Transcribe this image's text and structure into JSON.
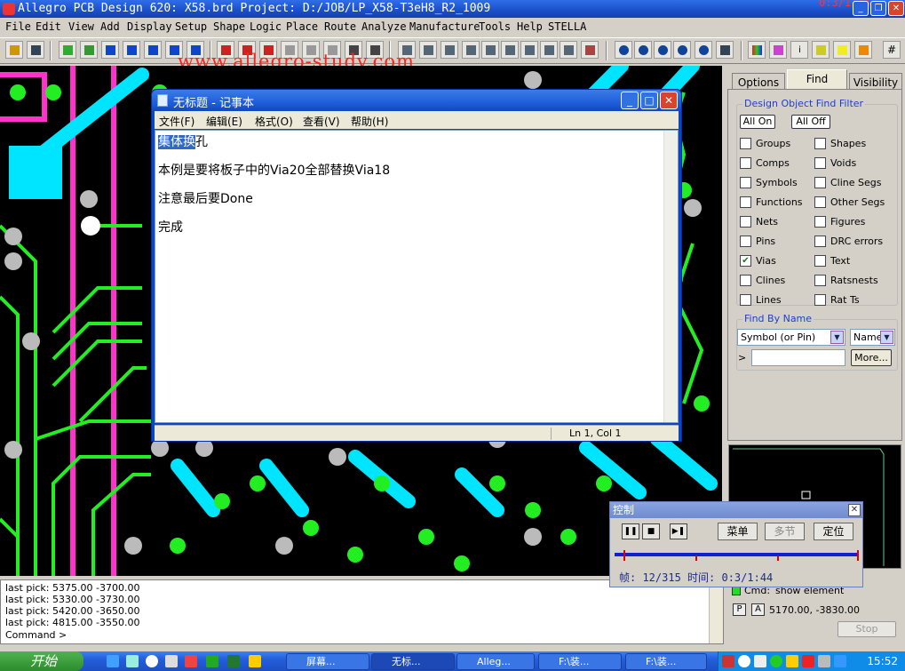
{
  "window": {
    "title": "Allegro PCB Design 620: X58.brd  Project: D:/JOB/LP_X58-T3eH8_R2_1009",
    "timer_overlay": "0:3/1:44"
  },
  "menu": [
    "File",
    "Edit",
    "View",
    "Add",
    "Display",
    "Setup",
    "Shape",
    "Logic",
    "Place",
    "Route",
    "Analyze",
    "Manufacture",
    "Tools",
    "Help",
    "STELLA"
  ],
  "watermark": "www.allegro-study.com",
  "command_window": {
    "lines": [
      "last pick:  5375.00  -3700.00",
      "last pick:  5330.00  -3730.00",
      "last pick:  5420.00  -3650.00",
      "last pick:  4815.00  -3550.00",
      "Command >"
    ]
  },
  "right_panel": {
    "tabs": [
      "Options",
      "Find",
      "Visibility"
    ],
    "active_tab": "Find",
    "filter": {
      "title": "Design Object Find Filter",
      "all_on": "All On",
      "all_off": "All Off",
      "items": [
        {
          "label": "Groups",
          "checked": false
        },
        {
          "label": "Shapes",
          "checked": false
        },
        {
          "label": "Comps",
          "checked": false
        },
        {
          "label": "Voids",
          "checked": false
        },
        {
          "label": "Symbols",
          "checked": false
        },
        {
          "label": "Cline Segs",
          "checked": false
        },
        {
          "label": "Functions",
          "checked": false
        },
        {
          "label": "Other Segs",
          "checked": false
        },
        {
          "label": "Nets",
          "checked": false
        },
        {
          "label": "Figures",
          "checked": false
        },
        {
          "label": "Pins",
          "checked": false
        },
        {
          "label": "DRC errors",
          "checked": false
        },
        {
          "label": "Vias",
          "checked": true
        },
        {
          "label": "Text",
          "checked": false
        },
        {
          "label": "Clines",
          "checked": false
        },
        {
          "label": "Ratsnests",
          "checked": false
        },
        {
          "label": "Lines",
          "checked": false
        },
        {
          "label": "Rat Ts",
          "checked": false
        }
      ]
    },
    "find_by_name": {
      "title": "Find By Name",
      "type_value": "Symbol (or Pin)",
      "name_value": "Name",
      "more_button": "More...",
      "arrow": ">"
    },
    "status": {
      "cmd_label": "Cmd:",
      "cmd_value": "show element",
      "coords": "5170.00, -3830.00",
      "p": "P",
      "a": "A",
      "stop": "Stop"
    }
  },
  "notepad": {
    "title": "无标题 - 记事本",
    "menu": [
      "文件(F)",
      "编辑(E)",
      "格式(O)",
      "查看(V)",
      "帮助(H)"
    ],
    "lines": [
      "集体换孔",
      "本例是要将板子中的Via20全部替换Via18",
      "注意最后要Done",
      "完成"
    ],
    "selected_text": "集体换",
    "rest_text": "孔",
    "status": "Ln 1, Col 1"
  },
  "control": {
    "title": "控制",
    "menu_button": "菜单",
    "multi_button": "多节",
    "locate_button": "定位",
    "info": "帧: 12/315  时间: 0:3/1:44",
    "progress": 0.038
  },
  "taskbar": {
    "start": "开始",
    "tasks": [
      "屏幕...",
      "无标...",
      "Alleg...",
      "F:\\装...",
      "F:\\装..."
    ],
    "clock": "15:52"
  }
}
